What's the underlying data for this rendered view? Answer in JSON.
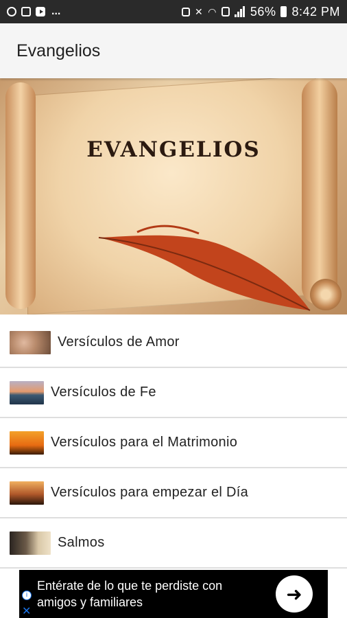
{
  "status_bar": {
    "time": "8:42 PM",
    "battery": "56%",
    "dots": "...",
    "icons_left": [
      "instagram-icon",
      "gallery-icon",
      "youtube-icon"
    ],
    "icons_right": [
      "lock-icon",
      "mute-icon",
      "wifi-icon",
      "sim-icon",
      "signal-icon",
      "battery-icon"
    ]
  },
  "app_bar": {
    "title": "Evangelios"
  },
  "banner": {
    "title": "EVANGELIOS"
  },
  "list": {
    "items": [
      {
        "label": "Versículos de Amor",
        "thumb": "hearts-thumbnail"
      },
      {
        "label": "Versículos de Fe",
        "thumb": "sunset-sea-thumbnail"
      },
      {
        "label": "Versículos para el Matrimonio",
        "thumb": "couple-sunset-thumbnail"
      },
      {
        "label": "Versículos para empezar el Día",
        "thumb": "person-sunrise-thumbnail"
      },
      {
        "label": "Salmos",
        "thumb": "praying-thumbnail"
      }
    ]
  },
  "ad": {
    "line1": "Entérate de lo que te perdiste con",
    "line2": "amigos y familiares",
    "info_icon": "i",
    "close_icon": "✕",
    "arrow_icon": "➜"
  }
}
